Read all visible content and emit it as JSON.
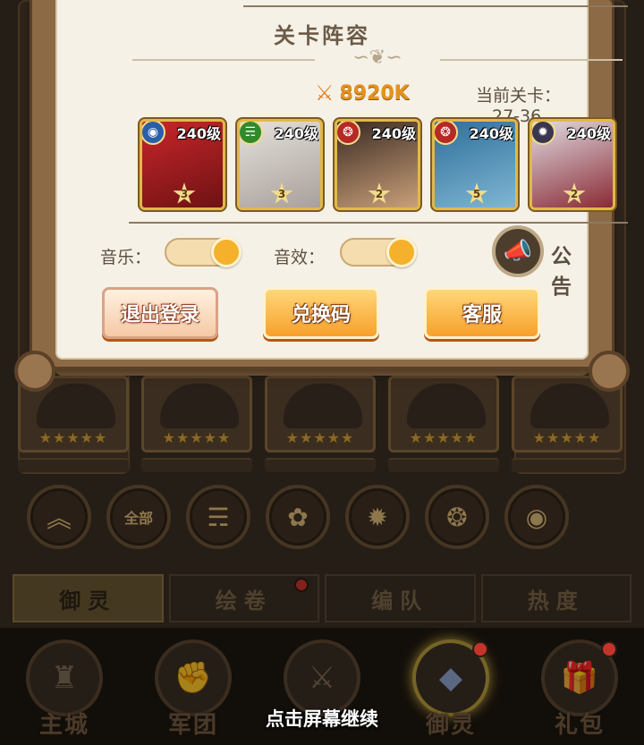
{
  "background": {
    "element_filters": [
      {
        "name": "scroll-up",
        "glyph": "︽"
      },
      {
        "name": "all",
        "label": "全部"
      },
      {
        "name": "wind",
        "glyph": "☴"
      },
      {
        "name": "light",
        "glyph": "✿"
      },
      {
        "name": "dark",
        "glyph": "✹"
      },
      {
        "name": "fire",
        "glyph": "❂"
      },
      {
        "name": "water",
        "glyph": "◉"
      }
    ],
    "tabs": [
      {
        "label": "御灵",
        "active": true,
        "badge": false
      },
      {
        "label": "绘卷",
        "active": false,
        "badge": true
      },
      {
        "label": "编队",
        "active": false,
        "badge": false
      },
      {
        "label": "热度",
        "active": false,
        "badge": false
      }
    ],
    "bottom_nav": [
      {
        "label": "主城",
        "icon": "♜",
        "active": false,
        "badge": false
      },
      {
        "label": "军团",
        "icon": "✊",
        "active": false,
        "badge": false
      },
      {
        "label": "",
        "icon": "⚔",
        "active": false,
        "badge": false
      },
      {
        "label": "御灵",
        "icon": "◆",
        "active": true,
        "badge": true
      },
      {
        "label": "礼包",
        "icon": "🎁",
        "active": false,
        "badge": true
      }
    ],
    "card_stars": "★★★★★",
    "continue_hint": "点击屏幕继续"
  },
  "panel": {
    "section_title": "关卡阵容",
    "ornament": "∽❦∽",
    "power_icon": "⚔",
    "power_value": "8920K",
    "stage_label": "当前关卡：",
    "stage_value": "27-36",
    "heroes": [
      {
        "level": "240级",
        "stars": "3",
        "element": "water",
        "badge_color": "#2a5fa8",
        "glyph": "◉",
        "portrait_colors": [
          "#c8262a",
          "#6e1214"
        ]
      },
      {
        "level": "240级",
        "stars": "3",
        "element": "wind",
        "badge_color": "#2f8a2c",
        "glyph": "☴",
        "portrait_colors": [
          "#e6e1dc",
          "#a8a09a"
        ]
      },
      {
        "level": "240级",
        "stars": "2",
        "element": "fire",
        "badge_color": "#b52a25",
        "glyph": "❂",
        "portrait_colors": [
          "#3a2a22",
          "#c9a07a"
        ]
      },
      {
        "level": "240级",
        "stars": "5",
        "element": "fire",
        "badge_color": "#b52a25",
        "glyph": "❂",
        "portrait_colors": [
          "#2f6f9a",
          "#7fb6d4"
        ]
      },
      {
        "level": "240级",
        "stars": "2",
        "element": "dark",
        "badge_color": "#3a3550",
        "glyph": "✹",
        "portrait_colors": [
          "#e0dbe2",
          "#8a2a34"
        ]
      }
    ],
    "music_label": "音乐：",
    "sfx_label": "音效：",
    "music_on": true,
    "sfx_on": true,
    "notice_label": "公告",
    "notice_icon": "📣",
    "buttons": {
      "logout": "退出登录",
      "redeem": "兑换码",
      "service": "客服"
    },
    "accent": "#f5b12c"
  }
}
